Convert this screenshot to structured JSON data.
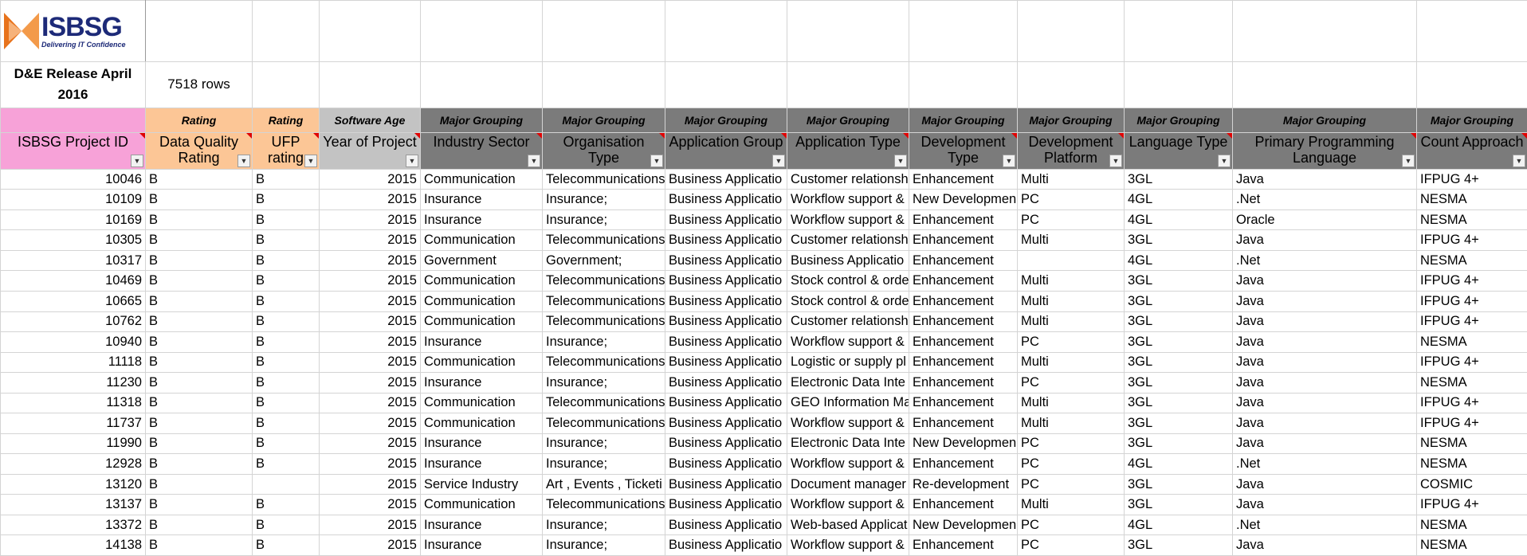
{
  "logo": {
    "name": "ISBSG",
    "tagline": "Delivering IT Confidence"
  },
  "release_title": "D&E Release April 2016",
  "row_count": "7518 rows",
  "colors": {
    "pink": "#f7a2d8",
    "peach": "#fcc696",
    "light_gray": "#c3c3c3",
    "dark_gray": "#7b7b7b",
    "red": "#e02020"
  },
  "groups": [
    "",
    "Rating",
    "Rating",
    "Software Age",
    "Major Grouping",
    "Major Grouping",
    "Major Grouping",
    "Major Grouping",
    "Major Grouping",
    "Major Grouping",
    "Major Grouping",
    "Major Grouping",
    "Major Grouping"
  ],
  "headers": [
    "ISBSG Project ID",
    "Data Quality Rating",
    "UFP rating",
    "Year of Project",
    "Industry Sector",
    "Organisation Type",
    "Application Group",
    "Application Type",
    "Development Type",
    "Development Platform",
    "Language Type",
    "Primary Programming Language",
    "Count Approach"
  ],
  "rows": [
    [
      "10046",
      "B",
      "B",
      "2015",
      "Communication",
      "Telecommunications",
      "Business Applicatio",
      "Customer relationsh",
      "Enhancement",
      "Multi",
      "3GL",
      "Java",
      "IFPUG 4+"
    ],
    [
      "10109",
      "B",
      "B",
      "2015",
      "Insurance",
      "Insurance;",
      "Business Applicatio",
      "Workflow support &",
      "New Developmen",
      "PC",
      "4GL",
      ".Net",
      "NESMA"
    ],
    [
      "10169",
      "B",
      "B",
      "2015",
      "Insurance",
      "Insurance;",
      "Business Applicatio",
      "Workflow support &",
      "Enhancement",
      "PC",
      "4GL",
      "Oracle",
      "NESMA"
    ],
    [
      "10305",
      "B",
      "B",
      "2015",
      "Communication",
      "Telecommunications",
      "Business Applicatio",
      "Customer relationsh",
      "Enhancement",
      "Multi",
      "3GL",
      "Java",
      "IFPUG 4+"
    ],
    [
      "10317",
      "B",
      "B",
      "2015",
      "Government",
      "Government;",
      "Business Applicatio",
      "Business Applicatio",
      "Enhancement",
      "",
      "4GL",
      ".Net",
      "NESMA"
    ],
    [
      "10469",
      "B",
      "B",
      "2015",
      "Communication",
      "Telecommunications",
      "Business Applicatio",
      "Stock control & orde",
      "Enhancement",
      "Multi",
      "3GL",
      "Java",
      "IFPUG 4+"
    ],
    [
      "10665",
      "B",
      "B",
      "2015",
      "Communication",
      "Telecommunications",
      "Business Applicatio",
      "Stock control & orde",
      "Enhancement",
      "Multi",
      "3GL",
      "Java",
      "IFPUG 4+"
    ],
    [
      "10762",
      "B",
      "B",
      "2015",
      "Communication",
      "Telecommunications",
      "Business Applicatio",
      "Customer relationsh",
      "Enhancement",
      "Multi",
      "3GL",
      "Java",
      "IFPUG 4+"
    ],
    [
      "10940",
      "B",
      "B",
      "2015",
      "Insurance",
      "Insurance;",
      "Business Applicatio",
      "Workflow support &",
      "Enhancement",
      "PC",
      "3GL",
      "Java",
      "NESMA"
    ],
    [
      "11118",
      "B",
      "B",
      "2015",
      "Communication",
      "Telecommunications",
      "Business Applicatio",
      "Logistic or supply pl",
      "Enhancement",
      "Multi",
      "3GL",
      "Java",
      "IFPUG 4+"
    ],
    [
      "11230",
      "B",
      "B",
      "2015",
      "Insurance",
      "Insurance;",
      "Business Applicatio",
      "Electronic Data Inte",
      "Enhancement",
      "PC",
      "3GL",
      "Java",
      "NESMA"
    ],
    [
      "11318",
      "B",
      "B",
      "2015",
      "Communication",
      "Telecommunications",
      "Business Applicatio",
      "GEO Information Ma",
      "Enhancement",
      "Multi",
      "3GL",
      "Java",
      "IFPUG 4+"
    ],
    [
      "11737",
      "B",
      "B",
      "2015",
      "Communication",
      "Telecommunications",
      "Business Applicatio",
      "Workflow support &",
      "Enhancement",
      "Multi",
      "3GL",
      "Java",
      "IFPUG 4+"
    ],
    [
      "11990",
      "B",
      "B",
      "2015",
      "Insurance",
      "Insurance;",
      "Business Applicatio",
      "Electronic Data Inte",
      "New Developmen",
      "PC",
      "3GL",
      "Java",
      "NESMA"
    ],
    [
      "12928",
      "B",
      "B",
      "2015",
      "Insurance",
      "Insurance;",
      "Business Applicatio",
      "Workflow support &",
      "Enhancement",
      "PC",
      "4GL",
      ".Net",
      "NESMA"
    ],
    [
      "13120",
      "B",
      "",
      "2015",
      "Service Industry",
      "Art , Events , Ticketi",
      "Business Applicatio",
      "Document manager",
      "Re-development",
      "PC",
      "3GL",
      "Java",
      "COSMIC"
    ],
    [
      "13137",
      "B",
      "B",
      "2015",
      "Communication",
      "Telecommunications",
      "Business Applicatio",
      "Workflow support &",
      "Enhancement",
      "Multi",
      "3GL",
      "Java",
      "IFPUG 4+"
    ],
    [
      "13372",
      "B",
      "B",
      "2015",
      "Insurance",
      "Insurance;",
      "Business Applicatio",
      "Web-based Applicat",
      "New Developmen",
      "PC",
      "4GL",
      ".Net",
      "NESMA"
    ],
    [
      "14138",
      "B",
      "B",
      "2015",
      "Insurance",
      "Insurance;",
      "Business Applicatio",
      "Workflow support &",
      "Enhancement",
      "PC",
      "3GL",
      "Java",
      "NESMA"
    ]
  ]
}
